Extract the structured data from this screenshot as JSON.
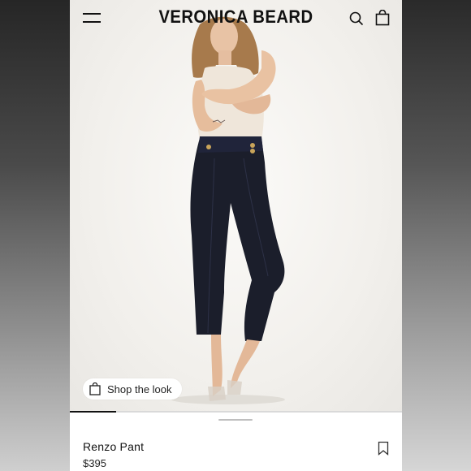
{
  "header": {
    "brand": "VERONICA BEARD",
    "menu_icon": "hamburger-menu-icon",
    "search_icon": "search-icon",
    "bag_icon": "shopping-bag-icon"
  },
  "hero": {
    "shop_the_look_label": "Shop the look",
    "shop_icon": "shopping-bag-icon",
    "carousel_progress": 0.14
  },
  "product": {
    "name": "Renzo Pant",
    "price": "$395",
    "save_icon": "bookmark-icon"
  },
  "colors": {
    "pant_navy": "#1b1e2b",
    "top_cream": "#efe6da",
    "background": "#f4f3f1"
  }
}
